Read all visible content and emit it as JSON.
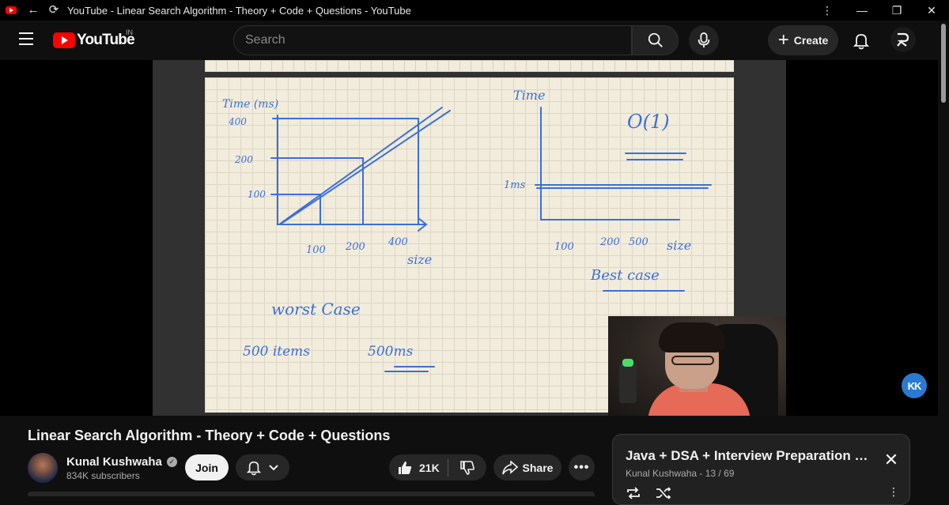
{
  "window": {
    "title": "YouTube - Linear Search Algorithm - Theory + Code + Questions - YouTube",
    "menu_icon": "⋮",
    "minimize_icon": "—",
    "restore_icon": "❐",
    "close_icon": "✕"
  },
  "header": {
    "logo_text": "YouTube",
    "region": "IN",
    "search_placeholder": "Search",
    "create_label": "Create",
    "colors": {
      "brand": "#ff0000",
      "background": "#0f0f0f"
    }
  },
  "video": {
    "title": "Linear Search Algorithm - Theory + Code + Questions",
    "watermark": "KK",
    "whiteboard": {
      "left_graph": {
        "y_label": "Time (ms)",
        "y_ticks": [
          "400",
          "200",
          "100"
        ],
        "x_ticks": [
          "100",
          "200",
          "400"
        ],
        "x_label": "size"
      },
      "right_graph": {
        "y_label": "Time",
        "y_tick": "1ms",
        "x_ticks": [
          "100",
          "200",
          "500"
        ],
        "x_label": "size",
        "big_o": "O(1)",
        "caption": "Best case"
      },
      "notes": {
        "case": "worst Case",
        "example": "500 items",
        "result": "500ms"
      }
    }
  },
  "channel": {
    "name": "Kunal Kushwaha",
    "subscribers": "834K subscribers",
    "join_label": "Join"
  },
  "actions": {
    "likes": "21K",
    "share_label": "Share",
    "more_label": "•••"
  },
  "playlist": {
    "title": "Java + DSA + Interview Preparation C...",
    "meta": "Kunal Kushwaha - 13 / 69",
    "close_icon": "✕",
    "more_icon": "⋮"
  }
}
